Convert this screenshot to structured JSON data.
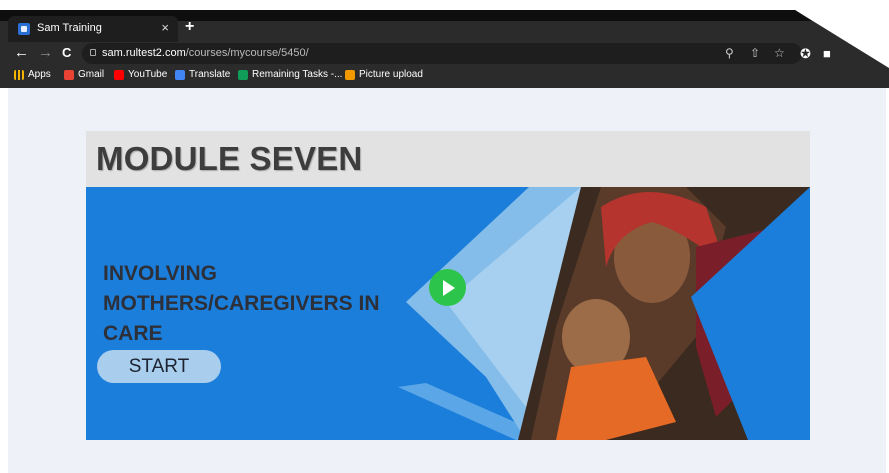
{
  "browser": {
    "tab_title": "Sam Training",
    "tab_close": "×",
    "new_tab": "+",
    "url_host": "sam.rultest2.com",
    "url_path": "/courses/mycourse/5450/",
    "nav": {
      "back": "←",
      "forward": "→",
      "reload": "C"
    },
    "omnibox_icons": [
      "zoom-icon",
      "share-icon",
      "star-icon"
    ],
    "toolbar_icons": [
      "extensions-icon",
      "sidepanel-icon"
    ]
  },
  "bookmarks": [
    {
      "label": "Apps",
      "icon": "apps-grid-icon",
      "color": "#f4b400"
    },
    {
      "label": "Gmail",
      "icon": "gmail-icon",
      "color": "#ea4335"
    },
    {
      "label": "YouTube",
      "icon": "youtube-icon",
      "color": "#ff0000"
    },
    {
      "label": "Translate",
      "icon": "translate-icon",
      "color": "#4285f4"
    },
    {
      "label": "Remaining Tasks -...",
      "icon": "sheets-icon",
      "color": "#0f9d58"
    },
    {
      "label": "Picture upload",
      "icon": "slides-icon",
      "color": "#f29900"
    }
  ],
  "page": {
    "module_title": "MODULE SEVEN",
    "banner_heading": "INVOLVING MOTHERS/CAREGIVERS IN CARE",
    "start_label": "START"
  },
  "colors": {
    "chrome": "#2b2b2b",
    "banner_blue": "#1b7edb",
    "play_green": "#2cc44a",
    "start_button": "#a9cdec",
    "header_bg": "#e2e2e2"
  }
}
